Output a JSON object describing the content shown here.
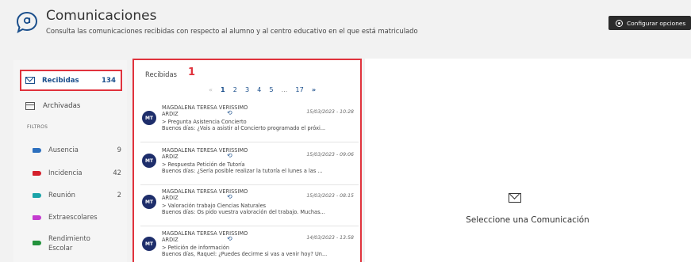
{
  "header": {
    "title": "Comunicaciones",
    "subtitle": "Consulta las comunicaciones recibidas con respecto al alumno y al centro educativo en el que está matriculado",
    "config_button": "Configurar opciones"
  },
  "sidebar": {
    "received": {
      "label": "Recibidas",
      "count": "134"
    },
    "archived": {
      "label": "Archivadas"
    },
    "filters_label": "FILTROS",
    "filters": [
      {
        "label": "Ausencia",
        "count": "9",
        "color": "#2c6fbe"
      },
      {
        "label": "Incidencia",
        "count": "42",
        "color": "#d4202c"
      },
      {
        "label": "Reunión",
        "count": "2",
        "color": "#1aa3a8"
      },
      {
        "label": "Extraescolares",
        "count": "",
        "color": "#c43ccf"
      },
      {
        "label": "Rendimiento Escolar",
        "count": "",
        "color": "#23923c"
      }
    ]
  },
  "list": {
    "title": "Recibidas",
    "marker": "1",
    "pagination": {
      "prev": "«",
      "pages": [
        "1",
        "2",
        "3",
        "4",
        "5"
      ],
      "ellipsis": "...",
      "last": "17",
      "next": "»"
    },
    "messages": [
      {
        "avatar": "MT",
        "sender": "MAGDALENA TERESA VERISSIMO ARDIZ",
        "date": "15/03/2023 - 10:28",
        "subject": "> Pregunta Asistencia Concierto",
        "preview": "Buenos días: ¿Vais a asistir al Concierto programado el próxi..."
      },
      {
        "avatar": "MT",
        "sender": "MAGDALENA TERESA VERISSIMO ARDIZ",
        "date": "15/03/2023 - 09:06",
        "subject": "> Respuesta Petición de Tutoría",
        "preview": "Buenos días: ¿Sería posible realizar la tutoría el lunes a las ..."
      },
      {
        "avatar": "MT",
        "sender": "MAGDALENA TERESA VERISSIMO ARDIZ",
        "date": "15/03/2023 - 08:15",
        "subject": "> Valoración trabajo Ciencias Naturales",
        "preview": "Buenos días: Os pido vuestra valoración del trabajo. Muchas..."
      },
      {
        "avatar": "MT",
        "sender": "MAGDALENA TERESA VERISSIMO ARDIZ",
        "date": "14/03/2023 - 13:58",
        "subject": "> Petición de información",
        "preview": "Buenos días, Raquel: ¿Puedes decirme si vas a venir hoy? Un..."
      }
    ]
  },
  "detail": {
    "empty_text": "Seleccione una Comunicación"
  },
  "icons": {
    "logo": "chat-bubble-logo-icon",
    "reply": "reply-arrow-icon",
    "mail": "envelope-icon",
    "archive": "archive-box-icon",
    "settings": "gear-icon"
  }
}
